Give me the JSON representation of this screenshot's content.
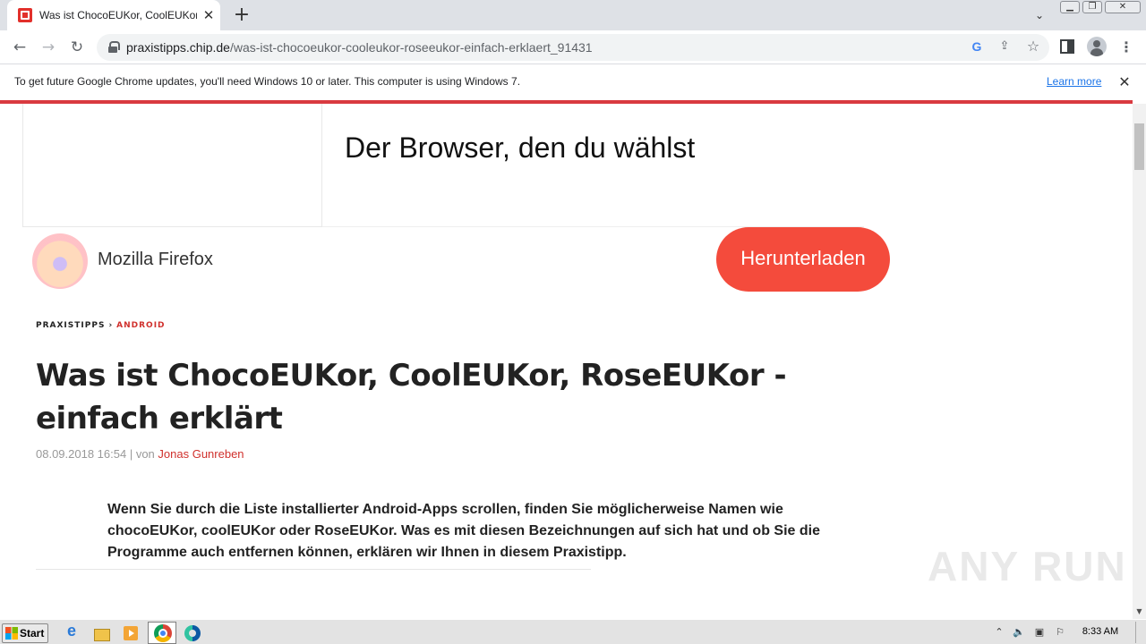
{
  "browser": {
    "tab": {
      "title": "Was ist ChocoEUKor, CoolEUKor, RoseEUKor - einfach erklärt",
      "favicon": "chip-favicon"
    },
    "new_tab_label": "+",
    "url": {
      "domain": "praxistipps.chip.de",
      "path": "/was-ist-chocoeukor-cooleukor-roseeukor-einfach-erklaert_91431"
    },
    "infobar": {
      "message": "To get future Google Chrome updates, you'll need Windows 10 or later. This computer is using Windows 7.",
      "link": "Learn more"
    },
    "accent_color": "#d93a40"
  },
  "ad": {
    "headline": "Der Browser, den du wählst",
    "brand": "Mozilla Firefox",
    "cta": "Herunterladen",
    "cta_color": "#f44b3c"
  },
  "article": {
    "breadcrumb": [
      "PRAXISTIPPS",
      "ANDROID"
    ],
    "breadcrumb_separator": "›",
    "title": "Was ist ChocoEUKor, CoolEUKor, RoseEUKor - einfach erklärt",
    "meta": {
      "date": "08.09.2018 16:54",
      "by": " | von ",
      "author": "Jonas Gunreben"
    },
    "lead": "Wenn Sie durch die Liste installierter Android-Apps scrollen, finden Sie möglicherweise Namen wie chocoEUKor, coolEUKor oder RoseEUKor. Was es mit diesen Bezeichnungen auf sich hat und ob Sie die Programme auch entfernen können, erklären wir Ihnen in diesem Praxistipp.",
    "link_color": "#d0312d"
  },
  "watermark": "ANY RUN",
  "taskbar": {
    "start_label": "Start",
    "clock": "8:33 AM"
  }
}
